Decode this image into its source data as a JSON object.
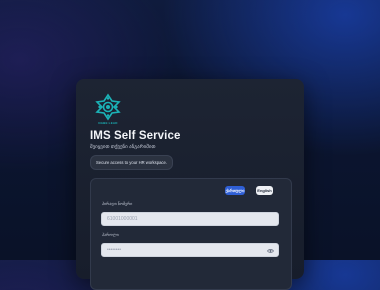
{
  "brand": {
    "logo_caption": "NABE LEAD",
    "teal": "#1bb3b7"
  },
  "header": {
    "title": "IMS Self Service",
    "subtitle": "შეიყვით თქვენი ანგარიშით",
    "tagline": "Secure access to your HR workspace."
  },
  "language": {
    "georgian": "ქართული",
    "english": "English",
    "active": "georgian",
    "active_color": "#2f5fd6"
  },
  "form": {
    "username_label": "პირადი ნომერი",
    "username_placeholder": "61001000001",
    "password_label": "პაროლი",
    "password_placeholder": "••••••••",
    "password_toggle_icon": "eye-icon"
  }
}
